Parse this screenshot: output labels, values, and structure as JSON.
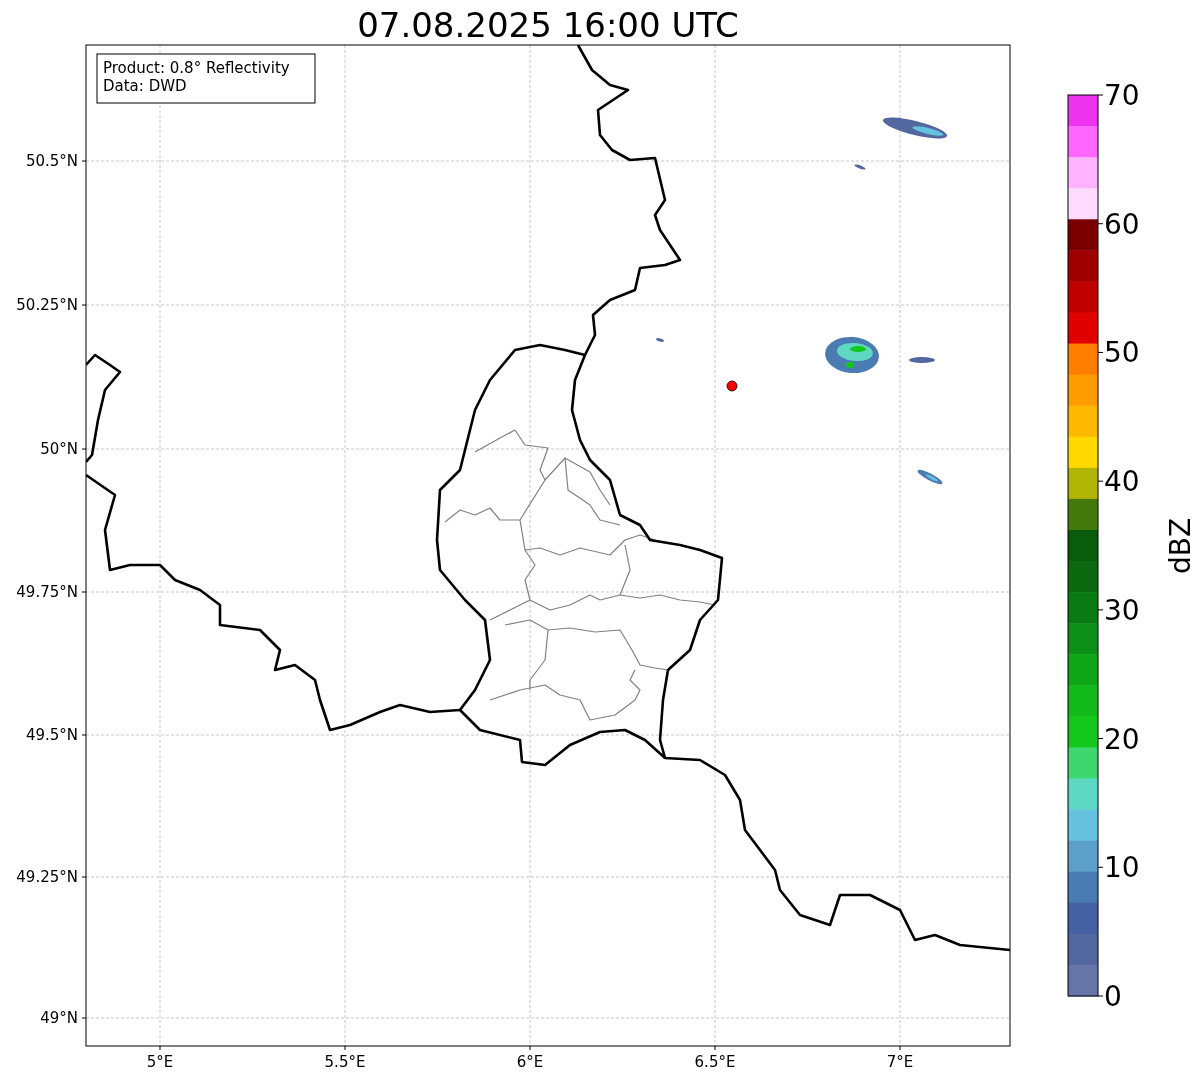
{
  "title": "07.08.2025 16:00 UTC",
  "info_box": [
    "Product: 0.8° Reflectivity",
    "Data: DWD"
  ],
  "x_ticks": [
    "5°E",
    "5.5°E",
    "6°E",
    "6.5°E",
    "7°E"
  ],
  "y_ticks": [
    "50.5°N",
    "50.25°N",
    "50°N",
    "49.75°N",
    "49.5°N",
    "49.25°N",
    "49°N"
  ],
  "colorbar": {
    "label": "dBZ",
    "ticks": [
      "70",
      "60",
      "50",
      "40",
      "30",
      "20",
      "10",
      "0"
    ],
    "bins": [
      {
        "color": "#ee33ee"
      },
      {
        "color": "#ff66ff"
      },
      {
        "color": "#ffb3ff"
      },
      {
        "color": "#ffdcff"
      },
      {
        "color": "#7a0000"
      },
      {
        "color": "#a00000"
      },
      {
        "color": "#c00000"
      },
      {
        "color": "#e00000"
      },
      {
        "color": "#ff7e00"
      },
      {
        "color": "#ff9c00"
      },
      {
        "color": "#ffb800"
      },
      {
        "color": "#ffd800"
      },
      {
        "color": "#b0b404"
      },
      {
        "color": "#447a0c"
      },
      {
        "color": "#085c0c"
      },
      {
        "color": "#0b6a10"
      },
      {
        "color": "#0a7a14"
      },
      {
        "color": "#0b8f16"
      },
      {
        "color": "#0ea616"
      },
      {
        "color": "#12b91a"
      },
      {
        "color": "#13c81a"
      },
      {
        "color": "#3ed66e"
      },
      {
        "color": "#5fd8c3"
      },
      {
        "color": "#66c2de"
      },
      {
        "color": "#5c9fc8"
      },
      {
        "color": "#4b7bb3"
      },
      {
        "color": "#4361a3"
      },
      {
        "color": "#53679f"
      },
      {
        "color": "#6674a8"
      }
    ]
  }
}
